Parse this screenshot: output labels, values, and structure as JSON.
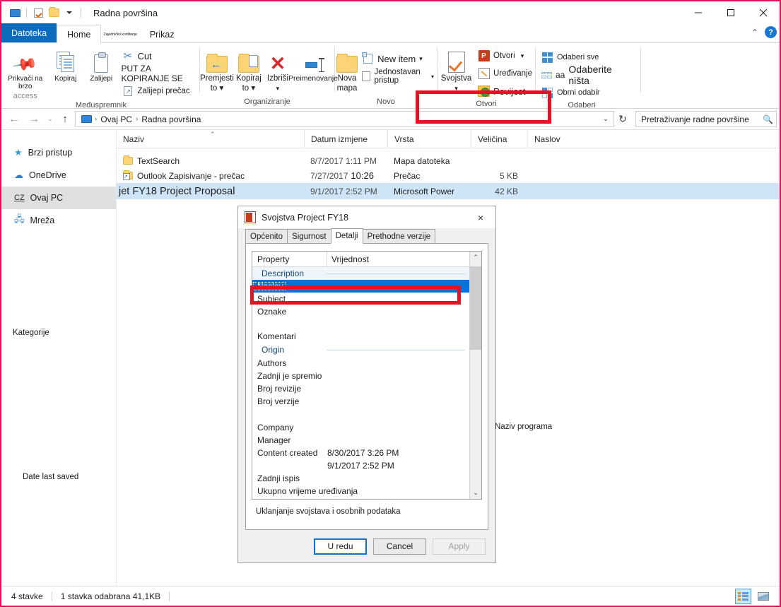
{
  "window": {
    "title": "Radna površina",
    "quick_access": [
      "monitor-icon",
      "properties-check-icon",
      "new-folder-icon",
      "dropdown-caret"
    ],
    "controls": {
      "minimize": "minimize-icon",
      "maximize": "maximize-icon",
      "close": "close-icon"
    }
  },
  "tabs": [
    {
      "label": "Datoteka",
      "type": "file"
    },
    {
      "label": "Home",
      "type": "active"
    },
    {
      "label": "Zajedničko korištenje",
      "type": "squish"
    },
    {
      "label": "Prikaz",
      "type": "normal"
    }
  ],
  "ribbon": {
    "help_label": "?",
    "collapse_label": "⌃",
    "groups": [
      {
        "name": "Međuspremnik",
        "label": "Međuspremnik",
        "big_buttons": [
          {
            "label_top": "Prikvači na brzo",
            "label_bottom": "access",
            "icon": "pin-icon"
          },
          {
            "label_top": "Kopiraj",
            "label_bottom": "",
            "icon": "copy-icon"
          },
          {
            "label_top": "Zalijepi",
            "label_bottom": "",
            "icon": "paste-icon"
          }
        ],
        "small_buttons": [
          {
            "label": "Cut",
            "icon": "scissors-icon"
          },
          {
            "label": "PUT ZA KOPIRANJE SE",
            "icon": "none"
          },
          {
            "label": "Zalijepi prečac",
            "icon": "paste-shortcut-icon"
          }
        ]
      },
      {
        "name": "Organiziranje",
        "label": "Organiziranje",
        "big_buttons": [
          {
            "label_top": "Premjesti",
            "label_bottom": "to",
            "icon": "move-to-icon",
            "has_caret": true
          },
          {
            "label_top": "Kopiraj",
            "label_bottom": "to",
            "icon": "copy-to-icon",
            "has_caret": true
          },
          {
            "label_top": "Izbriši",
            "label_bottom": "",
            "icon": "delete-icon",
            "has_caret": true
          },
          {
            "label_top": "Preimenovanje",
            "label_bottom": "",
            "icon": "rename-icon"
          }
        ]
      },
      {
        "name": "Novo",
        "label": "Novo",
        "big_buttons": [
          {
            "label_top": "Nova",
            "label_bottom": "mapa",
            "icon": "new-folder-icon"
          }
        ],
        "small_buttons": [
          {
            "label": "New item",
            "icon": "new-item-icon",
            "has_caret": true
          },
          {
            "label": "Jednostavan pristup",
            "icon": "easy-access-icon",
            "has_caret": true
          }
        ]
      },
      {
        "name": "Otvori",
        "label": "Otvori",
        "big_buttons": [
          {
            "label_top": "Svojstva",
            "label_bottom": "",
            "icon": "properties-icon",
            "has_caret": true
          }
        ],
        "small_buttons": [
          {
            "label": "Otvori",
            "icon": "powerpoint-icon",
            "has_caret": true
          },
          {
            "label": "Uređivanje",
            "icon": "edit-pencil-icon"
          },
          {
            "label": "Povijest",
            "icon": "history-icon"
          }
        ]
      },
      {
        "name": "Odaberi",
        "label": "Odaberi",
        "small_buttons": [
          {
            "label": "Odaberi sve",
            "icon": "select-all-icon"
          },
          {
            "label": "Odaberite ništa",
            "icon": "select-none-icon",
            "prefix": "aa"
          },
          {
            "label": "Obrni odabir",
            "icon": "invert-selection-icon"
          }
        ]
      }
    ]
  },
  "addressbar": {
    "back": "←",
    "forward": "→",
    "recent": "⌄",
    "up": "↑",
    "crumbs": [
      "Ovaj PC",
      "Radna površina"
    ],
    "crumb_separator": "›",
    "dropdown": "⌄",
    "refresh": "↻",
    "search_placeholder": "Pretraživanje radne površine",
    "search_icon": "search-icon"
  },
  "navpane": {
    "items": [
      {
        "label": "Brzi pristup",
        "icon": "star-icon",
        "selected": false
      },
      {
        "label": "OneDrive",
        "icon": "cloud-icon",
        "selected": false
      },
      {
        "label": "Ovaj PC",
        "icon": "pc-icon",
        "prefix": "CZ",
        "selected": true
      },
      {
        "label": "Mreža",
        "icon": "network-icon",
        "selected": false
      }
    ]
  },
  "filelist": {
    "columns": [
      "Naziv",
      "Datum izmjene",
      "Vrsta",
      "Veličina",
      "Naslov"
    ],
    "sort_indicator": "⌃",
    "rows": [
      {
        "name": "TextSearch",
        "date": "8/7/2017 1:11 PM",
        "type": "Mapa datoteka",
        "size": "",
        "title": "",
        "icon": "folder-icon",
        "selected": false,
        "big": false
      },
      {
        "name": "Outlook Zapisivanje - prečac",
        "date": "7/27/2017",
        "date2": "10:26",
        "type": "Prečac",
        "size": "5 KB",
        "title": "",
        "icon": "shortcut-icon",
        "selected": false,
        "big": false
      },
      {
        "name": "jet FY18 Project Proposal",
        "date": "9/1/2017 2:52 PM",
        "type": "Microsoft Power",
        "size": "42 KB",
        "title": "",
        "icon": "none",
        "selected": true,
        "big": true
      }
    ]
  },
  "statusbar": {
    "item_count": "4 stavke",
    "selection": "1 stavka odabrana 41,1KB",
    "view_details_icon": "details-view-icon",
    "view_thumbs_icon": "thumbnail-view-icon"
  },
  "dialog": {
    "title": "Svojstva Project FY18",
    "icon": "powerpoint-file-icon",
    "close": "×",
    "tabs": [
      {
        "label": "Općenito",
        "active": false
      },
      {
        "label": "Sigurnost",
        "active": false
      },
      {
        "label": "Detalji",
        "active": true
      },
      {
        "label": "Prethodne verzije",
        "active": false
      }
    ],
    "prop_headers": [
      "Property",
      "Vrijednost"
    ],
    "rows": [
      {
        "key": "Description",
        "value": "",
        "kind": "section"
      },
      {
        "key": "Naslov",
        "value": "",
        "kind": "selected"
      },
      {
        "key": "Subject",
        "value": "",
        "kind": "normal"
      },
      {
        "key": "Oznake",
        "value": "",
        "kind": "normal"
      },
      {
        "key": "",
        "value": "",
        "kind": "normal"
      },
      {
        "key": "Komentari",
        "value": "",
        "kind": "normal"
      },
      {
        "key": "Origin",
        "value": "",
        "kind": "section"
      },
      {
        "key": "Authors",
        "value": "",
        "kind": "normal"
      },
      {
        "key": "Zadnji je spremio",
        "value": "",
        "kind": "normal"
      },
      {
        "key": "Broj revizije",
        "value": "",
        "kind": "normal"
      },
      {
        "key": "Broj verzije",
        "value": "",
        "kind": "normal"
      },
      {
        "key": "",
        "value": "",
        "kind": "normal"
      },
      {
        "key": "Company",
        "value": "",
        "kind": "normal"
      },
      {
        "key": "Manager",
        "value": "",
        "kind": "normal"
      },
      {
        "key": "Content created",
        "value": "8/30/2017 3:26 PM",
        "kind": "normal"
      },
      {
        "key": "",
        "value": "9/1/2017 2:52 PM",
        "kind": "normal"
      },
      {
        "key": "Zadnji ispis",
        "value": "",
        "kind": "normal"
      },
      {
        "key": "Ukupno vrijeme uređivanja",
        "value": "",
        "kind": "normal"
      }
    ],
    "scroll_up": "⌃",
    "scroll_down": "⌄",
    "link": "Uklanjanje svojstava i osobnih podataka",
    "buttons": [
      {
        "label": "U redu",
        "style": "default"
      },
      {
        "label": "Cancel",
        "style": "normal"
      },
      {
        "label": "Apply",
        "style": "disabled"
      }
    ]
  },
  "annotations": {
    "categories": "Kategorije",
    "date_last_saved": "Date last saved",
    "program_name": "Naziv programa"
  },
  "colors": {
    "accent": "#0b6cbd",
    "highlight_box": "#e81123",
    "selection": "#cfe4f7",
    "prop_selection": "#0a73d6",
    "page_border": "#e2115e"
  }
}
